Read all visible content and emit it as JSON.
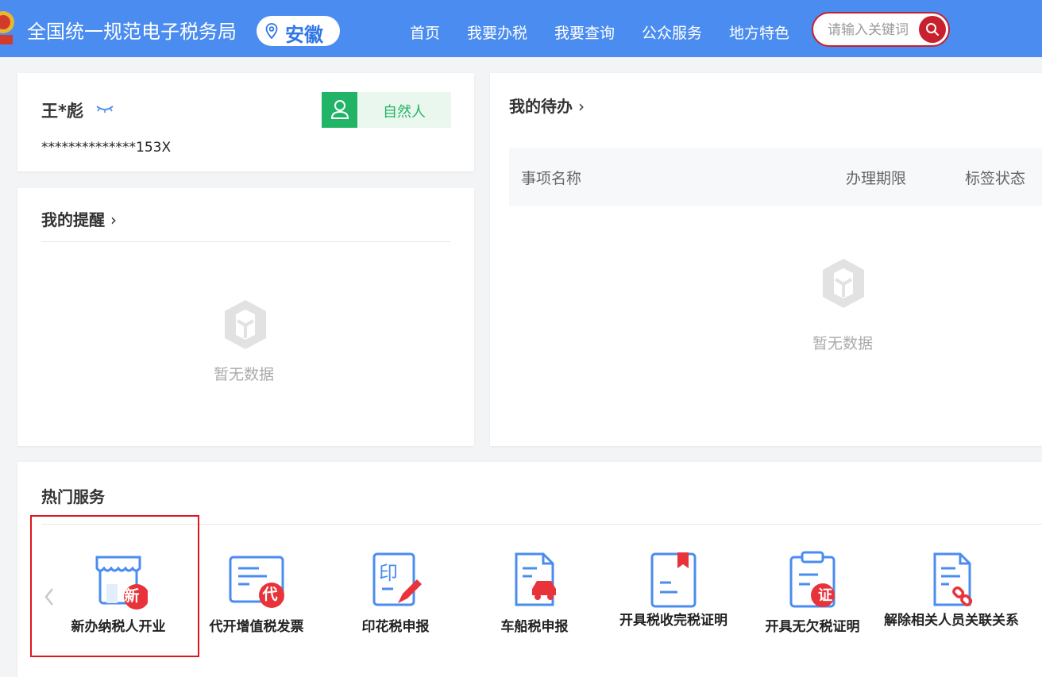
{
  "header": {
    "site_title": "全国统一规范电子税务局",
    "region": "安徽",
    "nav": [
      "首页",
      "我要办税",
      "我要查询",
      "公众服务",
      "地方特色"
    ],
    "search_placeholder": "请输入关键词",
    "brand_color": "#4a8cf0",
    "search_color": "#c8202c"
  },
  "user": {
    "name": "王*彪",
    "id_masked": "**************153X",
    "role": "自然人",
    "role_color": "#21b467"
  },
  "reminders": {
    "title": "我的提醒",
    "chevron": "›",
    "empty_text": "暂无数据"
  },
  "todos": {
    "title": "我的待办",
    "chevron": "›",
    "columns": [
      "事项名称",
      "办理期限",
      "标签状态"
    ],
    "empty_text": "暂无数据"
  },
  "hot_services": {
    "title": "热门服务",
    "items": [
      {
        "label": "新办纳税人开业",
        "badge": "新",
        "icon": "shop-icon"
      },
      {
        "label": "代开增值税发票",
        "badge": "代",
        "icon": "invoice-icon"
      },
      {
        "label": "印花税申报",
        "badge": "",
        "icon": "stamp-edit-icon"
      },
      {
        "label": "车船税申报",
        "badge": "",
        "icon": "car-document-icon"
      },
      {
        "label": "开具税收完税证明",
        "badge": "",
        "icon": "bookmark-document-icon"
      },
      {
        "label": "开具无欠税证明",
        "badge": "证",
        "icon": "clipboard-certificate-icon"
      },
      {
        "label": "解除相关人员关联关系",
        "badge": "",
        "icon": "unlink-document-icon"
      }
    ]
  }
}
